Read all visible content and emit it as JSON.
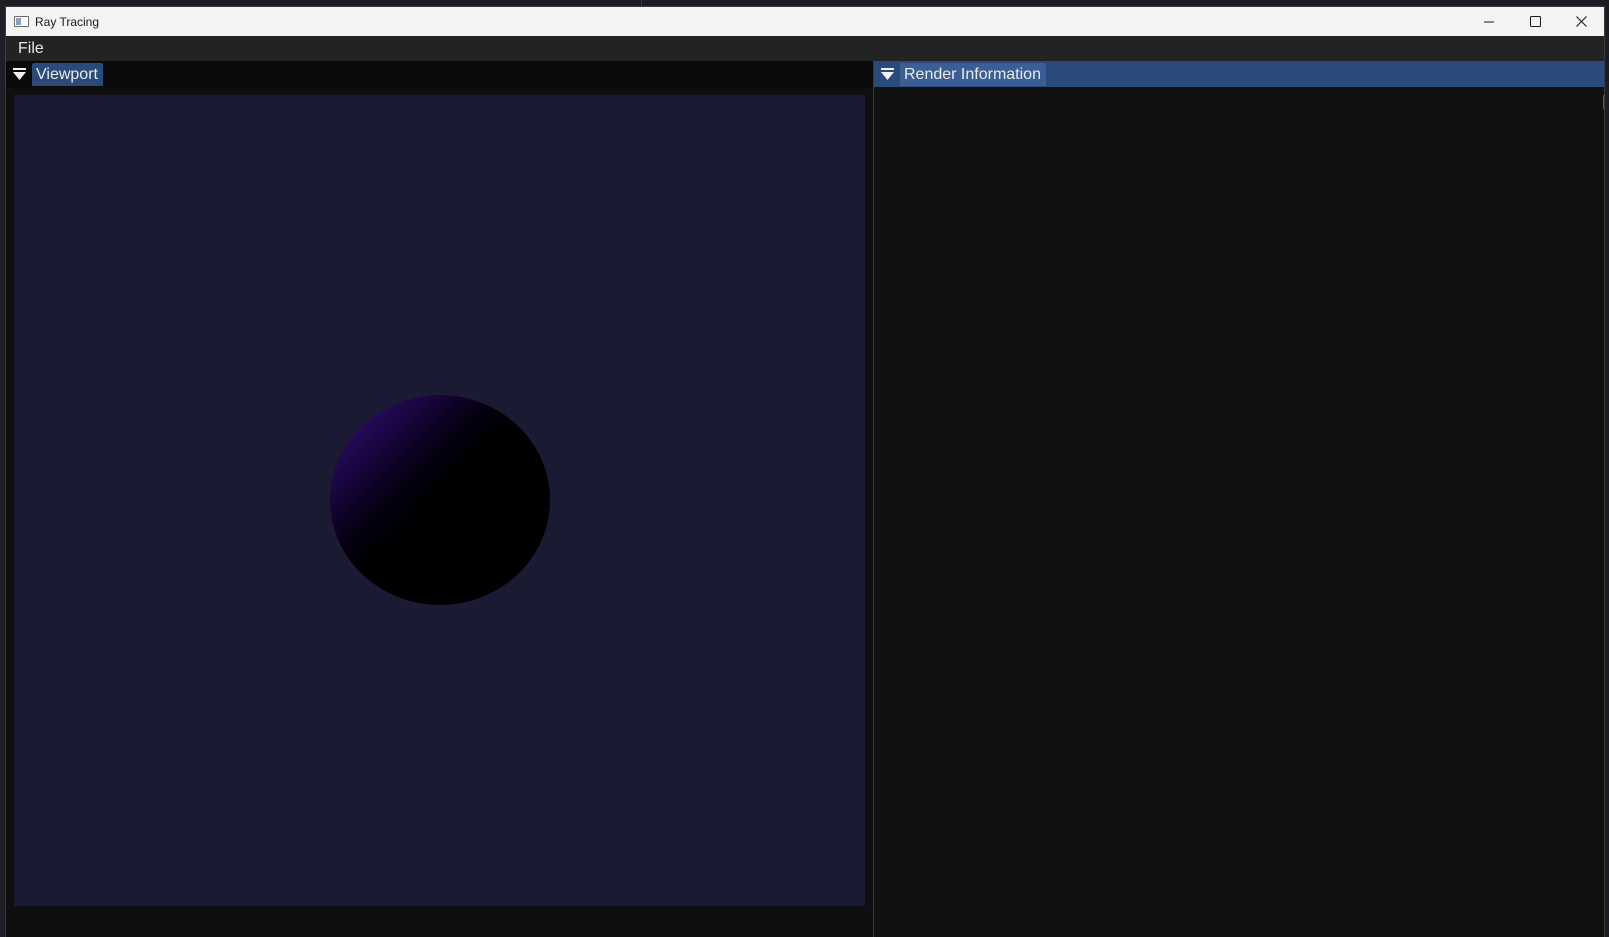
{
  "window": {
    "title": "Ray Tracing",
    "app_icon": "window-app-icon"
  },
  "caption": {
    "minimize_icon": "minimize-icon",
    "maximize_icon": "maximize-icon",
    "close_icon": "close-icon"
  },
  "menu": {
    "items": [
      {
        "label": "File"
      }
    ]
  },
  "panels": {
    "viewport": {
      "label": "Viewport",
      "collapse_icon": "triangle-down-icon"
    },
    "render_info": {
      "label": "Render Information",
      "collapse_icon": "triangle-down-icon"
    }
  },
  "colors": {
    "viewport_background": "#1a1a33",
    "sphere_highlight": "#35117a",
    "sphere_shadow": "#000000",
    "active_tab": "#294a7a",
    "menubar": "#232323",
    "panel_background": "#111111"
  }
}
